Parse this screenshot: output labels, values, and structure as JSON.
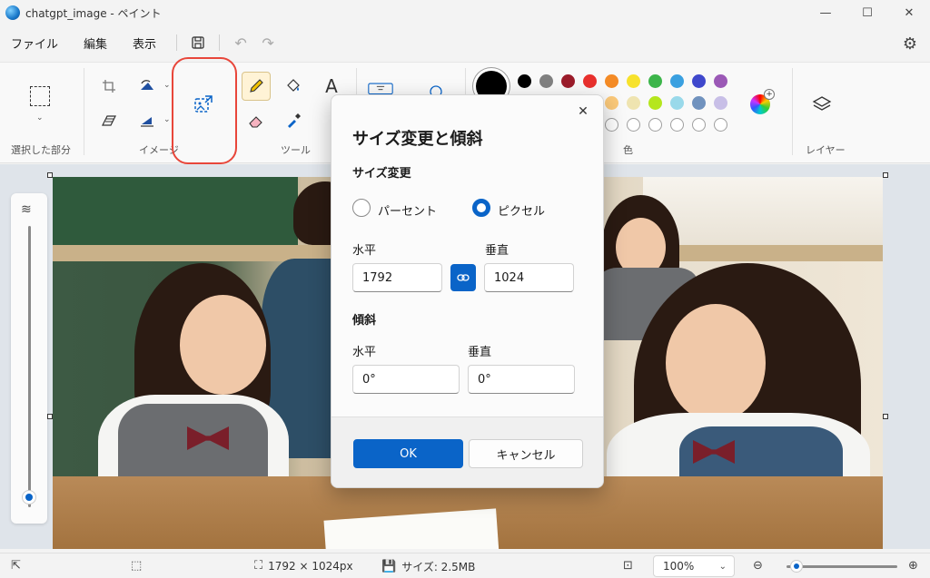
{
  "window": {
    "title": "chatgpt_image - ペイント",
    "controls": {
      "minimize": "—",
      "maximize": "☐",
      "close": "✕"
    }
  },
  "menu": {
    "items": [
      "ファイル",
      "編集",
      "表示"
    ],
    "save_icon": "save-icon",
    "undo_icon": "undo-icon",
    "redo_icon": "redo-icon",
    "settings_icon": "gear-icon"
  },
  "ribbon": {
    "groups": {
      "selection": "選択した部分",
      "image": "イメージ",
      "tools": "ツール",
      "colors": "色",
      "layers": "レイヤー"
    },
    "text_tool_glyph": "A",
    "current_color": "#000000",
    "palette_row1": [
      "#000000",
      "#808080",
      "#9b1c2a",
      "#e8302d",
      "#f48b26",
      "#f7e22c",
      "#3cb54a",
      "#3aa0e0",
      "#3f48cc",
      "#9b59b6"
    ],
    "palette_row2": [
      "#ffffff",
      "#c8c8c8",
      "#b97a57",
      "#f7b6c2",
      "#fbc97a",
      "#efe4b0",
      "#b5e61d",
      "#99d9ea",
      "#7092be",
      "#c8bfe7"
    ],
    "palette_row3_empty_count": 10
  },
  "dialog": {
    "title": "サイズ変更と傾斜",
    "resize_section": "サイズ変更",
    "option_percent": "パーセント",
    "option_pixel": "ピクセル",
    "selected_option": "ピクセル",
    "resize_horizontal_label": "水平",
    "resize_vertical_label": "垂直",
    "resize_horizontal_value": "1792",
    "resize_vertical_value": "1024",
    "skew_section": "傾斜",
    "skew_horizontal_label": "水平",
    "skew_vertical_label": "垂直",
    "skew_horizontal_value": "0°",
    "skew_vertical_value": "0°",
    "ok_label": "OK",
    "cancel_label": "キャンセル",
    "close_glyph": "✕"
  },
  "status": {
    "dimensions": "1792 × 1024px",
    "size": "サイズ: 2.5MB",
    "zoom": "100%",
    "zoom_level_fraction": 0.05
  }
}
